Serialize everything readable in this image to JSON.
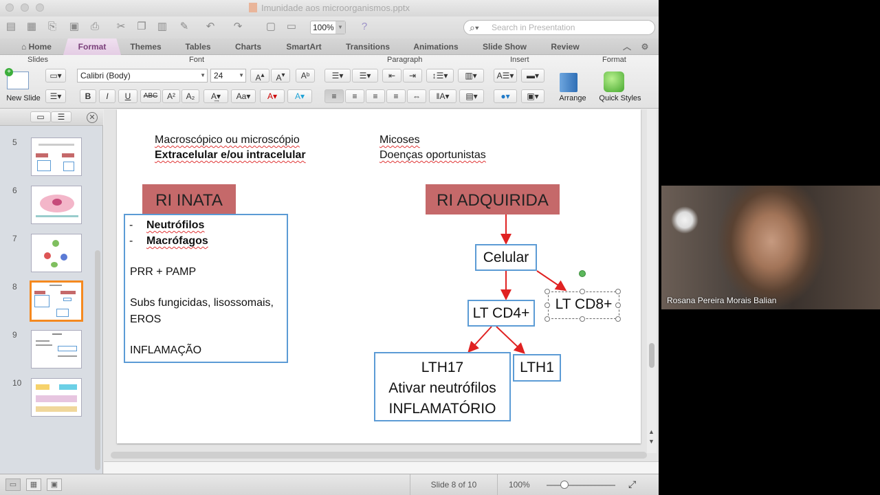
{
  "window": {
    "title": "Imunidade aos microorganismos.pptx"
  },
  "toolbar": {
    "zoom": "100%",
    "search_placeholder": "Search in Presentation"
  },
  "tabs": [
    "Home",
    "Format",
    "Themes",
    "Tables",
    "Charts",
    "SmartArt",
    "Transitions",
    "Animations",
    "Slide Show",
    "Review"
  ],
  "ribbon": {
    "groups": {
      "slides": "Slides",
      "font": "Font",
      "paragraph": "Paragraph",
      "insert": "Insert",
      "format": "Format"
    },
    "new_slide": "New Slide",
    "font_name": "Calibri (Body)",
    "font_size": "24",
    "bold": "B",
    "italic": "I",
    "underline": "U",
    "strike": "ABC",
    "superscript": "A²",
    "subscript": "A₂",
    "arrange": "Arrange",
    "quick_styles": "Quick Styles"
  },
  "thumbnails": [
    "5",
    "6",
    "7",
    "8",
    "9",
    "10"
  ],
  "slide": {
    "line1_left": "Macroscópico ou microscópio",
    "line2_left": "Extracelular e/ou intracelular",
    "line1_right": "Micoses",
    "line2_right": "Doenças oportunistas",
    "ri_inata": "RI INATA",
    "ri_adquirida": "RI ADQUIRIDA",
    "dash": "-",
    "neutrofilos": "Neutrófilos",
    "macrofagos": "Macrófagos",
    "prr_pamp": "PRR + PAMP",
    "subs_line1": "Subs fungicidas, lisossomais,",
    "subs_line2": "EROS",
    "inflamacao": "INFLAMAÇÃO",
    "celular": "Celular",
    "lt_cd4": "LT CD4+",
    "lt_cd8": "LT CD8+",
    "lth17_line1": "LTH17",
    "lth17_line2": "Ativar neutrófilos",
    "lth17_line3": "INFLAMATÓRIO",
    "lth1": "LTH1"
  },
  "status": {
    "slide_of": "Slide 8 of 10",
    "zoom": "100%"
  },
  "video": {
    "participant_name": "Rosana Pereira Morais Balian"
  }
}
